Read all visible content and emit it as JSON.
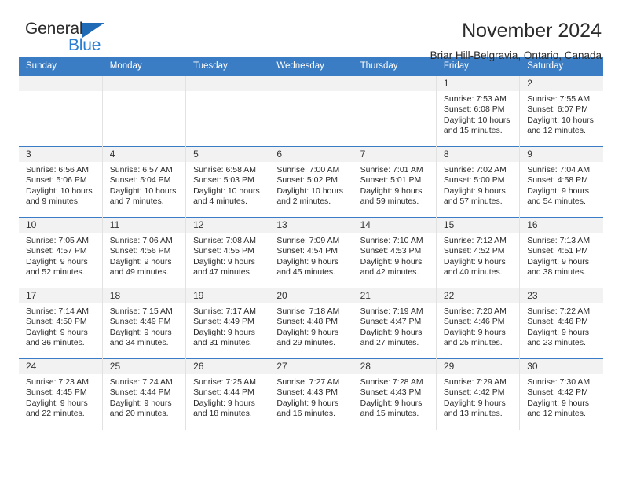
{
  "logo": {
    "primary_text": "General",
    "secondary_text": "Blue",
    "triangle_color": "#1f6bb5",
    "secondary_color": "#2a7fd4"
  },
  "header": {
    "title": "November 2024",
    "subtitle": "Briar Hill-Belgravia, Ontario, Canada"
  },
  "theme": {
    "header_row_bg": "#3b7dc4",
    "daynum_bg": "#f2f2f2",
    "grid_line": "#3b7dc4",
    "text": "#2b2b2b"
  },
  "weekday_headers": [
    "Sunday",
    "Monday",
    "Tuesday",
    "Wednesday",
    "Thursday",
    "Friday",
    "Saturday"
  ],
  "labels": {
    "sunrise_prefix": "Sunrise:",
    "sunset_prefix": "Sunset:",
    "daylight_prefix": "Daylight:"
  },
  "weeks": [
    [
      {
        "day": "",
        "empty": true
      },
      {
        "day": "",
        "empty": true
      },
      {
        "day": "",
        "empty": true
      },
      {
        "day": "",
        "empty": true
      },
      {
        "day": "",
        "empty": true
      },
      {
        "day": "1",
        "sunrise": "Sunrise: 7:53 AM",
        "sunset": "Sunset: 6:08 PM",
        "daylight": "Daylight: 10 hours and 15 minutes."
      },
      {
        "day": "2",
        "sunrise": "Sunrise: 7:55 AM",
        "sunset": "Sunset: 6:07 PM",
        "daylight": "Daylight: 10 hours and 12 minutes."
      }
    ],
    [
      {
        "day": "3",
        "sunrise": "Sunrise: 6:56 AM",
        "sunset": "Sunset: 5:06 PM",
        "daylight": "Daylight: 10 hours and 9 minutes."
      },
      {
        "day": "4",
        "sunrise": "Sunrise: 6:57 AM",
        "sunset": "Sunset: 5:04 PM",
        "daylight": "Daylight: 10 hours and 7 minutes."
      },
      {
        "day": "5",
        "sunrise": "Sunrise: 6:58 AM",
        "sunset": "Sunset: 5:03 PM",
        "daylight": "Daylight: 10 hours and 4 minutes."
      },
      {
        "day": "6",
        "sunrise": "Sunrise: 7:00 AM",
        "sunset": "Sunset: 5:02 PM",
        "daylight": "Daylight: 10 hours and 2 minutes."
      },
      {
        "day": "7",
        "sunrise": "Sunrise: 7:01 AM",
        "sunset": "Sunset: 5:01 PM",
        "daylight": "Daylight: 9 hours and 59 minutes."
      },
      {
        "day": "8",
        "sunrise": "Sunrise: 7:02 AM",
        "sunset": "Sunset: 5:00 PM",
        "daylight": "Daylight: 9 hours and 57 minutes."
      },
      {
        "day": "9",
        "sunrise": "Sunrise: 7:04 AM",
        "sunset": "Sunset: 4:58 PM",
        "daylight": "Daylight: 9 hours and 54 minutes."
      }
    ],
    [
      {
        "day": "10",
        "sunrise": "Sunrise: 7:05 AM",
        "sunset": "Sunset: 4:57 PM",
        "daylight": "Daylight: 9 hours and 52 minutes."
      },
      {
        "day": "11",
        "sunrise": "Sunrise: 7:06 AM",
        "sunset": "Sunset: 4:56 PM",
        "daylight": "Daylight: 9 hours and 49 minutes."
      },
      {
        "day": "12",
        "sunrise": "Sunrise: 7:08 AM",
        "sunset": "Sunset: 4:55 PM",
        "daylight": "Daylight: 9 hours and 47 minutes."
      },
      {
        "day": "13",
        "sunrise": "Sunrise: 7:09 AM",
        "sunset": "Sunset: 4:54 PM",
        "daylight": "Daylight: 9 hours and 45 minutes."
      },
      {
        "day": "14",
        "sunrise": "Sunrise: 7:10 AM",
        "sunset": "Sunset: 4:53 PM",
        "daylight": "Daylight: 9 hours and 42 minutes."
      },
      {
        "day": "15",
        "sunrise": "Sunrise: 7:12 AM",
        "sunset": "Sunset: 4:52 PM",
        "daylight": "Daylight: 9 hours and 40 minutes."
      },
      {
        "day": "16",
        "sunrise": "Sunrise: 7:13 AM",
        "sunset": "Sunset: 4:51 PM",
        "daylight": "Daylight: 9 hours and 38 minutes."
      }
    ],
    [
      {
        "day": "17",
        "sunrise": "Sunrise: 7:14 AM",
        "sunset": "Sunset: 4:50 PM",
        "daylight": "Daylight: 9 hours and 36 minutes."
      },
      {
        "day": "18",
        "sunrise": "Sunrise: 7:15 AM",
        "sunset": "Sunset: 4:49 PM",
        "daylight": "Daylight: 9 hours and 34 minutes."
      },
      {
        "day": "19",
        "sunrise": "Sunrise: 7:17 AM",
        "sunset": "Sunset: 4:49 PM",
        "daylight": "Daylight: 9 hours and 31 minutes."
      },
      {
        "day": "20",
        "sunrise": "Sunrise: 7:18 AM",
        "sunset": "Sunset: 4:48 PM",
        "daylight": "Daylight: 9 hours and 29 minutes."
      },
      {
        "day": "21",
        "sunrise": "Sunrise: 7:19 AM",
        "sunset": "Sunset: 4:47 PM",
        "daylight": "Daylight: 9 hours and 27 minutes."
      },
      {
        "day": "22",
        "sunrise": "Sunrise: 7:20 AM",
        "sunset": "Sunset: 4:46 PM",
        "daylight": "Daylight: 9 hours and 25 minutes."
      },
      {
        "day": "23",
        "sunrise": "Sunrise: 7:22 AM",
        "sunset": "Sunset: 4:46 PM",
        "daylight": "Daylight: 9 hours and 23 minutes."
      }
    ],
    [
      {
        "day": "24",
        "sunrise": "Sunrise: 7:23 AM",
        "sunset": "Sunset: 4:45 PM",
        "daylight": "Daylight: 9 hours and 22 minutes."
      },
      {
        "day": "25",
        "sunrise": "Sunrise: 7:24 AM",
        "sunset": "Sunset: 4:44 PM",
        "daylight": "Daylight: 9 hours and 20 minutes."
      },
      {
        "day": "26",
        "sunrise": "Sunrise: 7:25 AM",
        "sunset": "Sunset: 4:44 PM",
        "daylight": "Daylight: 9 hours and 18 minutes."
      },
      {
        "day": "27",
        "sunrise": "Sunrise: 7:27 AM",
        "sunset": "Sunset: 4:43 PM",
        "daylight": "Daylight: 9 hours and 16 minutes."
      },
      {
        "day": "28",
        "sunrise": "Sunrise: 7:28 AM",
        "sunset": "Sunset: 4:43 PM",
        "daylight": "Daylight: 9 hours and 15 minutes."
      },
      {
        "day": "29",
        "sunrise": "Sunrise: 7:29 AM",
        "sunset": "Sunset: 4:42 PM",
        "daylight": "Daylight: 9 hours and 13 minutes."
      },
      {
        "day": "30",
        "sunrise": "Sunrise: 7:30 AM",
        "sunset": "Sunset: 4:42 PM",
        "daylight": "Daylight: 9 hours and 12 minutes."
      }
    ]
  ]
}
